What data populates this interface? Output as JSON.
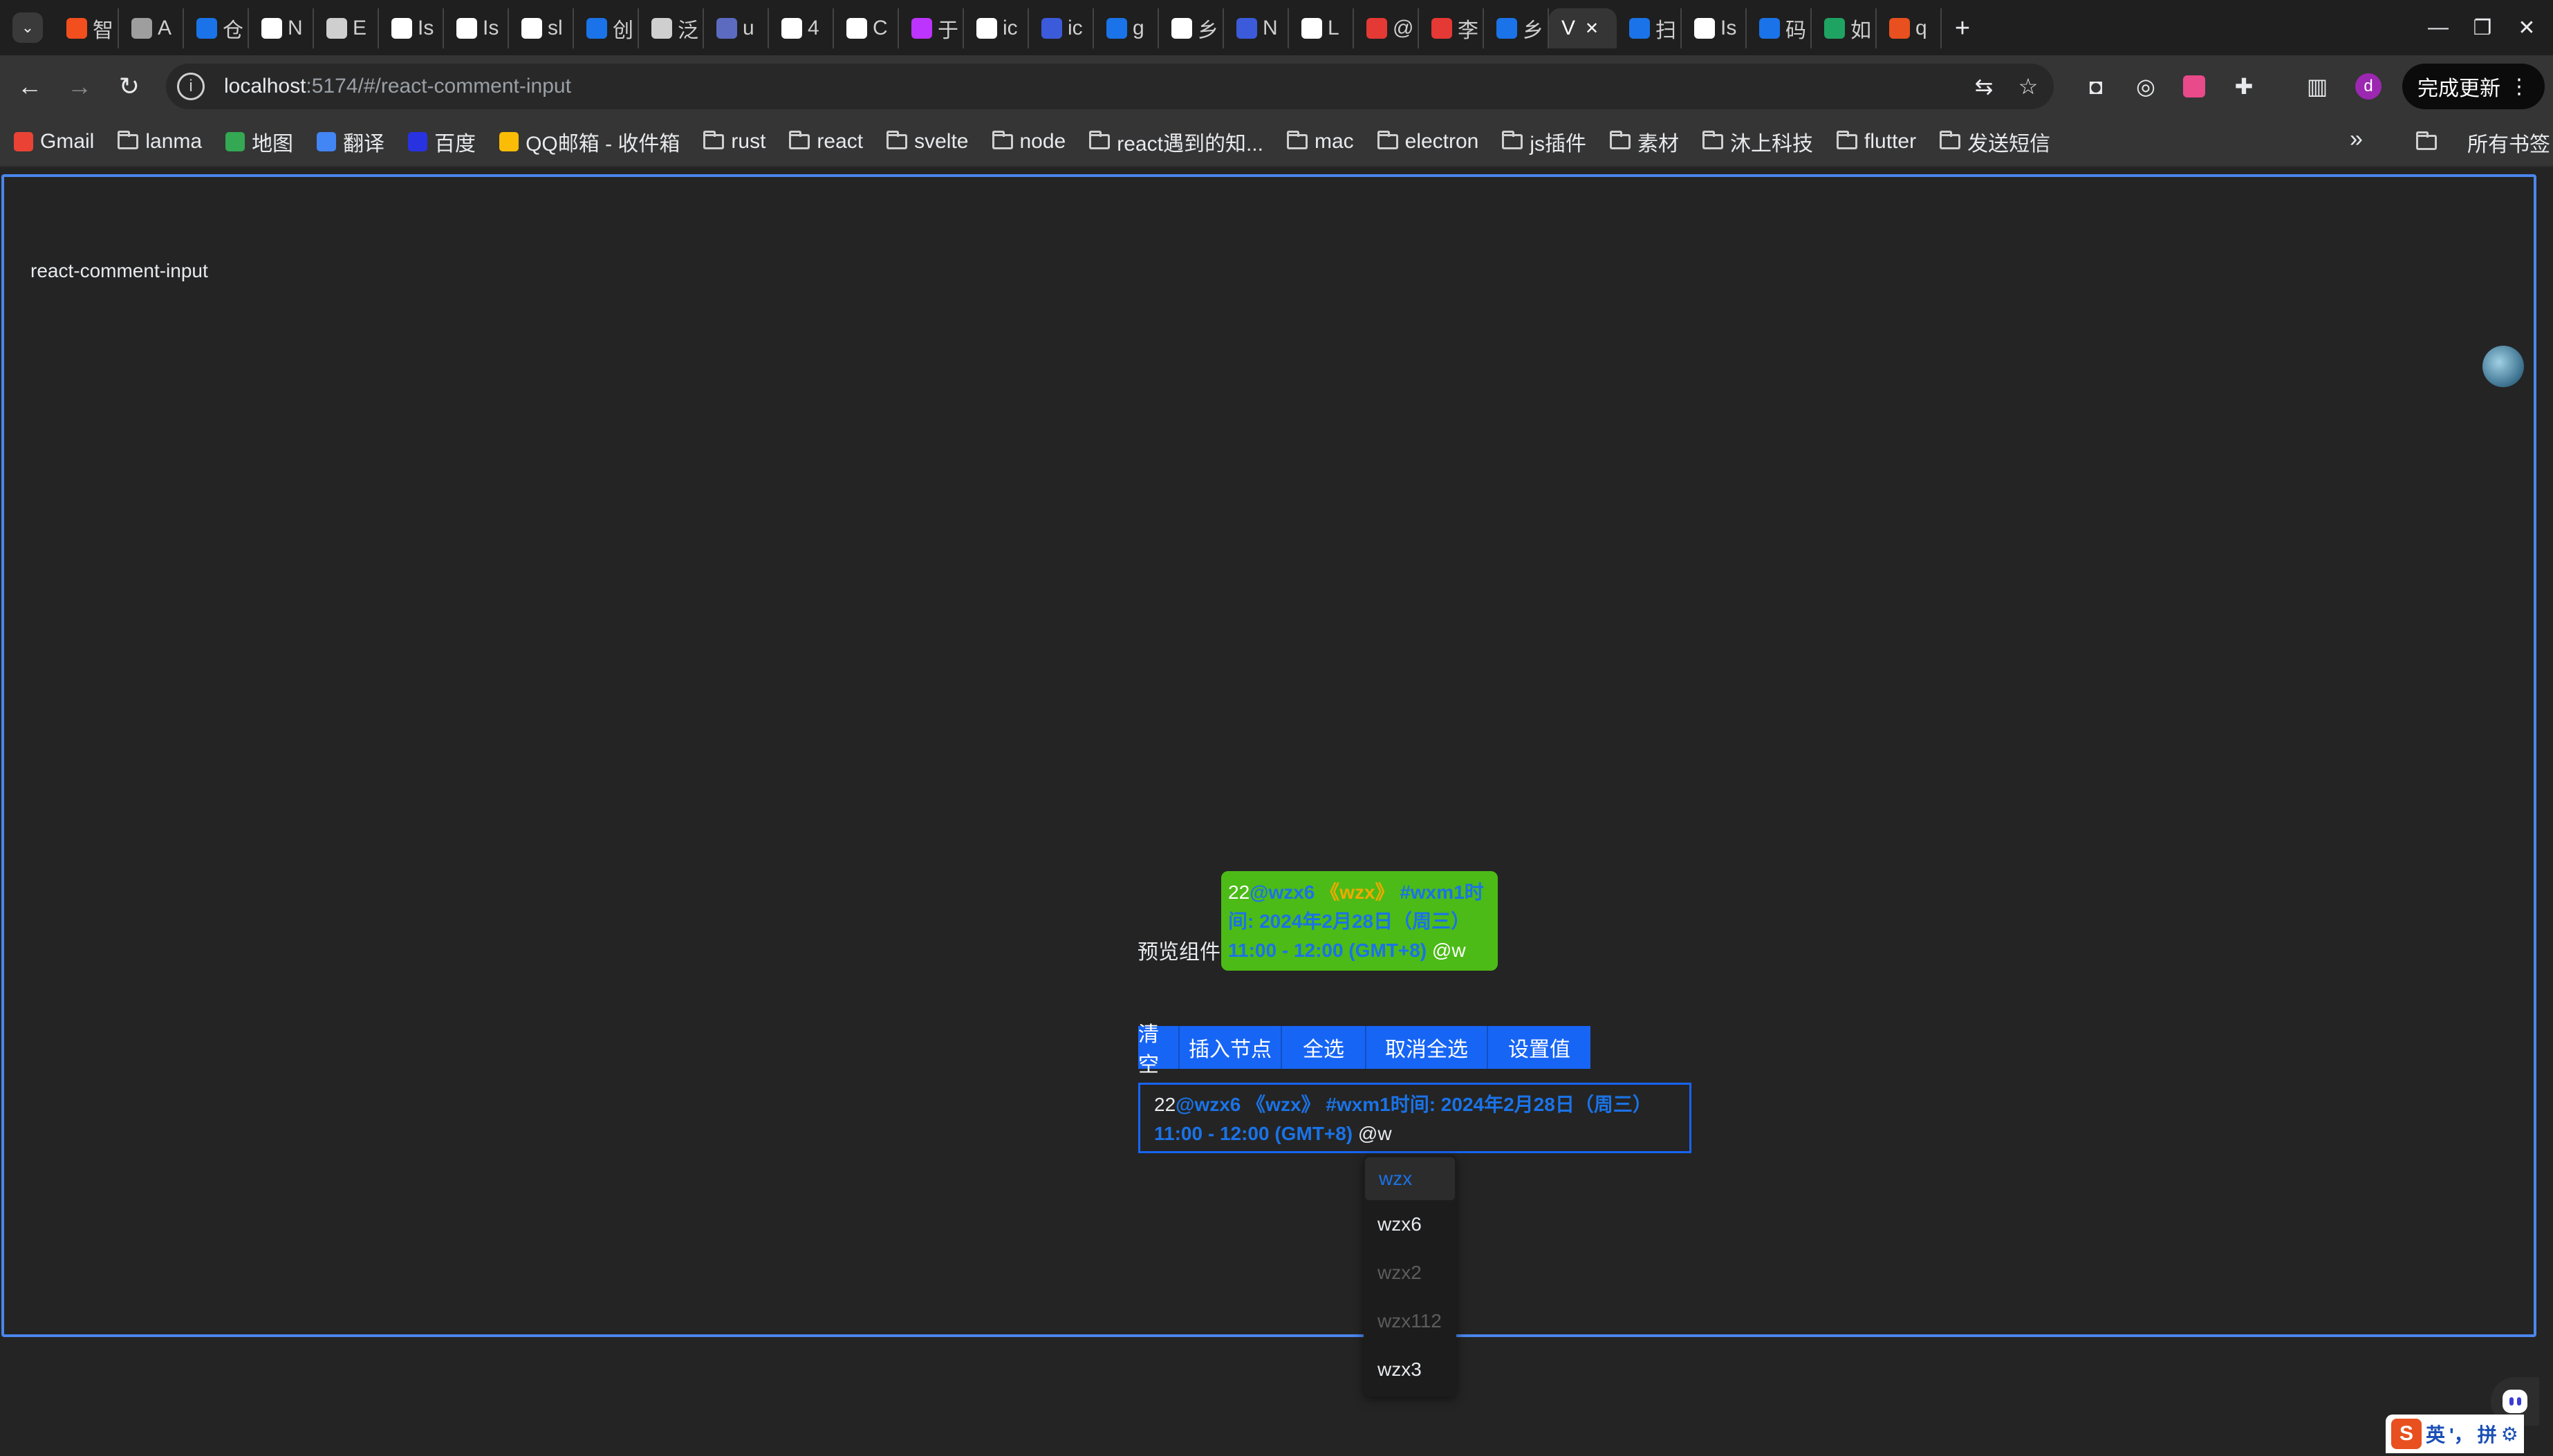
{
  "browser": {
    "tabs": [
      {
        "label": "智",
        "color": "#f24e1e"
      },
      {
        "label": "A",
        "color": "#9e9e9e"
      },
      {
        "label": "仓",
        "color": "#1a73e8"
      },
      {
        "label": "N",
        "color": "#ffffff"
      },
      {
        "label": "E",
        "color": "#cfcfcf"
      },
      {
        "label": "Is",
        "color": "#ffffff"
      },
      {
        "label": "Is",
        "color": "#ffffff"
      },
      {
        "label": "sl",
        "color": "#ffffff"
      },
      {
        "label": "创",
        "color": "#1a73e8"
      },
      {
        "label": "泛",
        "color": "#cfcfcf"
      },
      {
        "label": "u",
        "color": "#5c6bc0"
      },
      {
        "label": "4",
        "color": "#ffffff"
      },
      {
        "label": "C",
        "color": "#ffffff"
      },
      {
        "label": "于",
        "color": "#bd34fe"
      },
      {
        "label": "ic",
        "color": "#ffffff"
      },
      {
        "label": "ic",
        "color": "#3b5bdb"
      },
      {
        "label": "g",
        "color": "#1a73e8"
      },
      {
        "label": "乡",
        "color": "#ffffff"
      },
      {
        "label": "N",
        "color": "#3b5bdb"
      },
      {
        "label": "L",
        "color": "#ffffff"
      },
      {
        "label": "@",
        "color": "#e53935"
      },
      {
        "label": "李",
        "color": "#e53935"
      },
      {
        "label": "乡",
        "color": "#1a73e8"
      }
    ],
    "active_tab": {
      "label": "V"
    },
    "tabs_after": [
      {
        "label": "扫",
        "color": "#1a73e8"
      },
      {
        "label": "Is",
        "color": "#ffffff"
      },
      {
        "label": "码",
        "color": "#1a73e8"
      },
      {
        "label": "如",
        "color": "#1ea362"
      },
      {
        "label": "q",
        "color": "#e8501f"
      }
    ],
    "url_host": "localhost",
    "url_path": ":5174/#/react-comment-input",
    "update_label": "完成更新",
    "avatar_letter": "d",
    "bookmarks": [
      {
        "label": "Gmail",
        "type": "site",
        "color": "#ea4335"
      },
      {
        "label": "lanma",
        "type": "folder"
      },
      {
        "label": "地图",
        "type": "site",
        "color": "#34a853"
      },
      {
        "label": "翻译",
        "type": "site",
        "color": "#4285f4"
      },
      {
        "label": "百度",
        "type": "site",
        "color": "#2932e1"
      },
      {
        "label": "QQ邮箱 - 收件箱",
        "type": "site",
        "color": "#fbbc05"
      },
      {
        "label": "rust",
        "type": "folder"
      },
      {
        "label": "react",
        "type": "folder"
      },
      {
        "label": "svelte",
        "type": "folder"
      },
      {
        "label": "node",
        "type": "folder"
      },
      {
        "label": "react遇到的知...",
        "type": "folder"
      },
      {
        "label": "mac",
        "type": "folder"
      },
      {
        "label": "electron",
        "type": "folder"
      },
      {
        "label": "js插件",
        "type": "folder"
      },
      {
        "label": "素材",
        "type": "folder"
      },
      {
        "label": "沐上科技",
        "type": "folder"
      },
      {
        "label": "flutter",
        "type": "folder"
      },
      {
        "label": "发送短信",
        "type": "folder"
      }
    ],
    "bookmarks_all": "所有书签"
  },
  "page": {
    "title": "react-comment-input",
    "preview_label": "预览组件:",
    "content": {
      "prefix": "22",
      "mention": "@wzx6",
      "book": "《wzx》",
      "topic": "#wxm1时间: 2024年2月28日（周三）11:00 - 12:00 (GMT+8)",
      "suffix": " @w"
    },
    "buttons": [
      "清空",
      "插入节点",
      "全选",
      "取消全选",
      "设置值"
    ],
    "dropdown": [
      {
        "label": "wzx",
        "state": "active"
      },
      {
        "label": "wzx6",
        "state": "normal"
      },
      {
        "label": "wzx2",
        "state": "disabled"
      },
      {
        "label": "wzx112",
        "state": "disabled"
      },
      {
        "label": "wzx3",
        "state": "normal"
      }
    ]
  },
  "ime": {
    "mode": "英",
    "punct": "'，",
    "input": "拼"
  },
  "colors": {
    "accent": "#1765f5",
    "frame": "#4a86ee",
    "preview_bg": "#4cbb17",
    "tag_blue": "#1a73e8",
    "tag_orange": "#f2a900"
  }
}
